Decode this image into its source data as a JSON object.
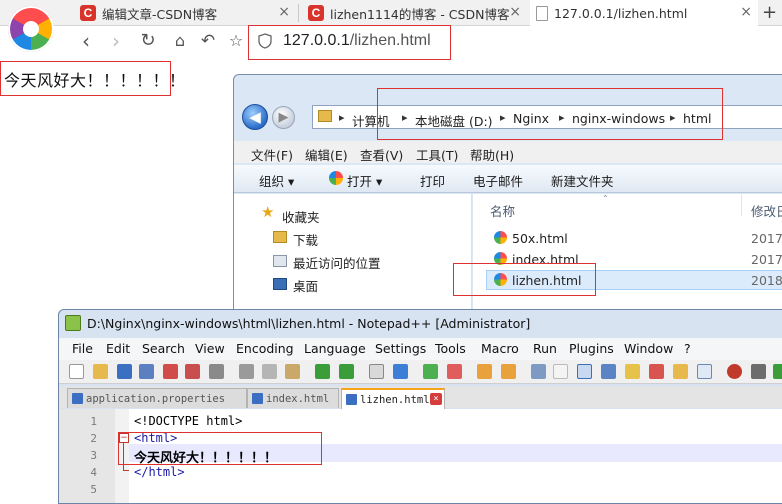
{
  "browser": {
    "tabs": [
      {
        "label": "编辑文章-CSDN博客",
        "icon": "csdn-logo-icon"
      },
      {
        "label": "lizhen1114的博客 - CSDN博客",
        "icon": "csdn-logo-icon"
      },
      {
        "label": "127.0.0.1/lizhen.html",
        "icon": "page-icon"
      }
    ],
    "new_tab": "+",
    "close_glyph": "×",
    "address": {
      "host": "127.0.0.1",
      "path": "/lizhen.html"
    },
    "page_text": "今天风好大！！！！！！"
  },
  "explorer": {
    "breadcrumb": [
      "计算机",
      "本地磁盘 (D:)",
      "Nginx",
      "nginx-windows",
      "html"
    ],
    "menu": [
      "文件(F)",
      "编辑(E)",
      "查看(V)",
      "工具(T)",
      "帮助(H)"
    ],
    "toolbar": {
      "organize": "组织 ▾",
      "open": "打开 ▾",
      "print": "打印",
      "email": "电子邮件",
      "new_folder": "新建文件夹"
    },
    "nav": {
      "favorites": "收藏夹",
      "downloads": "下载",
      "recent": "最近访问的位置",
      "desktop": "桌面"
    },
    "columns": {
      "name": "名称",
      "modified": "修改日"
    },
    "files": [
      {
        "name": "50x.html",
        "date": "2017/"
      },
      {
        "name": "index.html",
        "date": "2017/"
      },
      {
        "name": "lizhen.html",
        "date": "2018/"
      }
    ]
  },
  "notepad": {
    "title": "D:\\Nginx\\nginx-windows\\html\\lizhen.html - Notepad++ [Administrator]",
    "menu": [
      "File",
      "Edit",
      "Search",
      "View",
      "Encoding",
      "Language",
      "Settings",
      "Tools",
      "Macro",
      "Run",
      "Plugins",
      "Window",
      "?"
    ],
    "tabs": [
      "application.properties",
      "index.html",
      "lizhen.html"
    ],
    "lines": [
      {
        "num": "1",
        "text": "<!DOCTYPE html>"
      },
      {
        "num": "2",
        "text": "<html>"
      },
      {
        "num": "3",
        "text": "今天风好大！！！！！！"
      },
      {
        "num": "4",
        "text": "</html>"
      },
      {
        "num": "5",
        "text": ""
      }
    ]
  },
  "colors": {
    "highlight_red": "#e03131",
    "selection_blue": "#dcebfc",
    "csdn_red": "#d9342b"
  }
}
